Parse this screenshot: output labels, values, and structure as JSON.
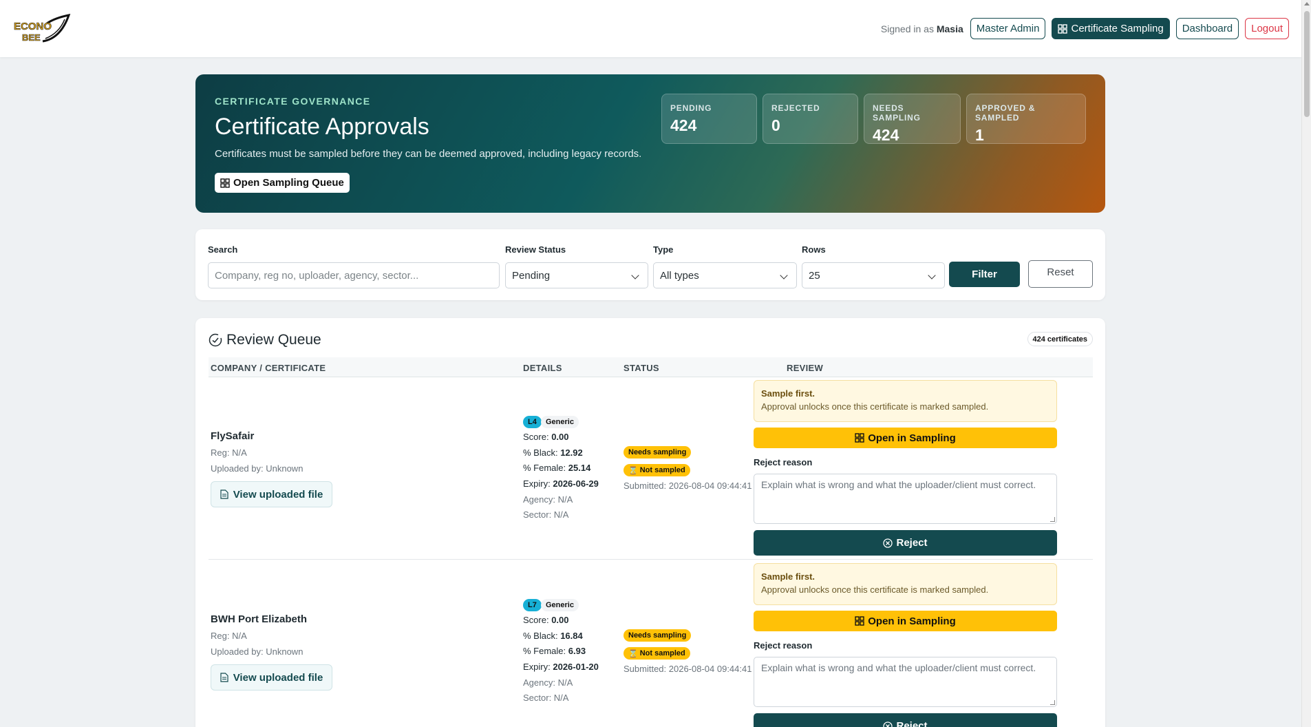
{
  "nav": {
    "logo_text": "ECONO BEE",
    "signed_in_prefix": "Signed in as",
    "user": "Masia",
    "master_admin": "Master Admin",
    "certificate_sampling": "Certificate Sampling",
    "dashboard": "Dashboard",
    "logout": "Logout"
  },
  "hero": {
    "eyebrow": "CERTIFICATE GOVERNANCE",
    "title": "Certificate Approvals",
    "description": "Certificates must be sampled before they can be deemed approved, including legacy records.",
    "button": "Open Sampling Queue",
    "stats": [
      {
        "label": "PENDING",
        "value": "424"
      },
      {
        "label": "REJECTED",
        "value": "0"
      },
      {
        "label": "NEEDS SAMPLING",
        "value": "424"
      },
      {
        "label": "APPROVED & SAMPLED",
        "value": "1"
      }
    ]
  },
  "filters": {
    "search_label": "Search",
    "search_placeholder": "Company, reg no, uploader, agency, sector...",
    "status_label": "Review Status",
    "status_value": "Pending",
    "type_label": "Type",
    "type_value": "All types",
    "rows_label": "Rows",
    "rows_value": "25",
    "filter_button": "Filter",
    "reset_button": "Reset"
  },
  "queue": {
    "title": "Review Queue",
    "count": "424 certificates",
    "columns": [
      "COMPANY / CERTIFICATE",
      "DETAILS",
      "STATUS",
      "REVIEW"
    ],
    "rows": [
      {
        "company": "FlySafair",
        "reg": "Reg: N/A",
        "uploaded_by": "Uploaded by: Unknown",
        "view_file": "View uploaded file",
        "level": "L4",
        "type": "Generic",
        "score_label": "Score:",
        "score": "0.00",
        "black_label": "% Black:",
        "black": "12.92",
        "female_label": "% Female:",
        "female": "25.14",
        "expiry_label": "Expiry:",
        "expiry": "2026-06-29",
        "agency": "Agency: N/A",
        "sector": "Sector: N/A",
        "status_needs": "Needs sampling",
        "status_not": "Not sampled",
        "submitted": "Submitted: 2026-08-04 09:44:41",
        "alert_title": "Sample first.",
        "alert_desc": "Approval unlocks once this certificate is marked sampled.",
        "open_sampling": "Open in Sampling",
        "reject_label": "Reject reason",
        "reject_placeholder": "Explain what is wrong and what the uploader/client must correct.",
        "reject_button": "Reject"
      },
      {
        "company": "BWH Port Elizabeth",
        "reg": "Reg: N/A",
        "uploaded_by": "Uploaded by: Unknown",
        "view_file": "View uploaded file",
        "level": "L7",
        "type": "Generic",
        "score_label": "Score:",
        "score": "0.00",
        "black_label": "% Black:",
        "black": "16.84",
        "female_label": "% Female:",
        "female": "6.93",
        "expiry_label": "Expiry:",
        "expiry": "2026-01-20",
        "agency": "Agency: N/A",
        "sector": "Sector: N/A",
        "status_needs": "Needs sampling",
        "status_not": "Not sampled",
        "submitted": "Submitted: 2026-08-04 09:44:41",
        "alert_title": "Sample first.",
        "alert_desc": "Approval unlocks once this certificate is marked sampled.",
        "open_sampling": "Open in Sampling",
        "reject_label": "Reject reason",
        "reject_placeholder": "Explain what is wrong and what the uploader/client must correct.",
        "reject_button": "Reject"
      }
    ]
  }
}
